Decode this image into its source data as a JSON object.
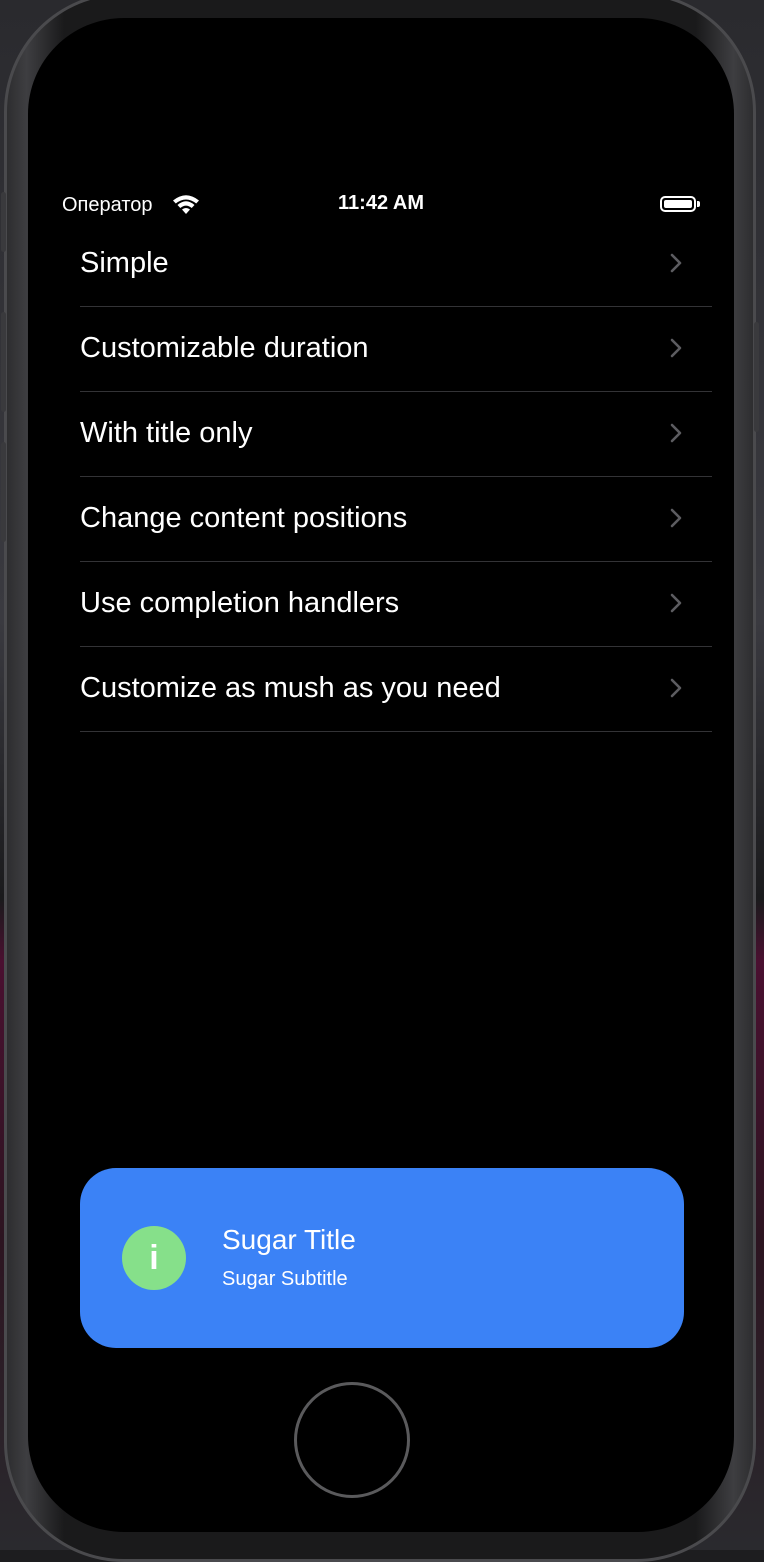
{
  "status_bar": {
    "carrier": "Оператор",
    "time": "11:42 AM"
  },
  "menu": {
    "items": [
      {
        "label": "Simple"
      },
      {
        "label": "Customizable duration"
      },
      {
        "label": "With title only"
      },
      {
        "label": "Change content positions"
      },
      {
        "label": "Use completion handlers"
      },
      {
        "label": "Customize as mush as you need"
      }
    ]
  },
  "toast": {
    "icon_glyph": "i",
    "icon_name": "info-icon",
    "title": "Sugar Title",
    "subtitle": "Sugar Subtitle"
  },
  "colors": {
    "toast_background": "#3b82f6",
    "icon_background": "#86e08a",
    "screen_background": "#000000",
    "separator": "#333336",
    "chevron": "#5c5c60"
  }
}
